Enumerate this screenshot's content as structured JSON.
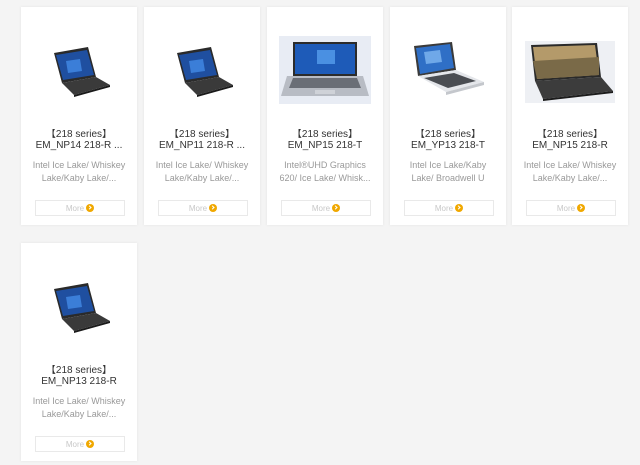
{
  "products": [
    {
      "series": "【218 series】",
      "model": "EM_NP14 218-R ...",
      "description": "Intel Ice Lake/ Whiskey Lake/Kaby Lake/...",
      "more_label": "More",
      "image": "laptop-dark-angled"
    },
    {
      "series": "【218 series】",
      "model": "EM_NP11 218-R ...",
      "description": "Intel Ice Lake/ Whiskey Lake/Kaby Lake/...",
      "more_label": "More",
      "image": "laptop-dark-angled"
    },
    {
      "series": "【218 series】",
      "model": "EM_NP15 218-T",
      "description": "Intel®UHD Graphics 620/ Ice Lake/ Whisk...",
      "more_label": "More",
      "image": "laptop-silver-front"
    },
    {
      "series": "【218 series】",
      "model": "EM_YP13 218-T",
      "description": "Intel Ice Lake/Kaby Lake/ Broadwell U",
      "more_label": "More",
      "image": "laptop-white-angled"
    },
    {
      "series": "【218 series】",
      "model": "EM_NP15 218-R",
      "description": "Intel Ice Lake/ Whiskey Lake/Kaby Lake/...",
      "more_label": "More",
      "image": "laptop-dark-landscape"
    },
    {
      "series": "【218 series】",
      "model": "EM_NP13 218-R",
      "description": "Intel Ice Lake/ Whiskey Lake/Kaby Lake/...",
      "more_label": "More",
      "image": "laptop-dark-angled"
    }
  ],
  "colors": {
    "more_icon": "#f0a800",
    "title_text": "#333333",
    "desc_text": "#999999"
  }
}
